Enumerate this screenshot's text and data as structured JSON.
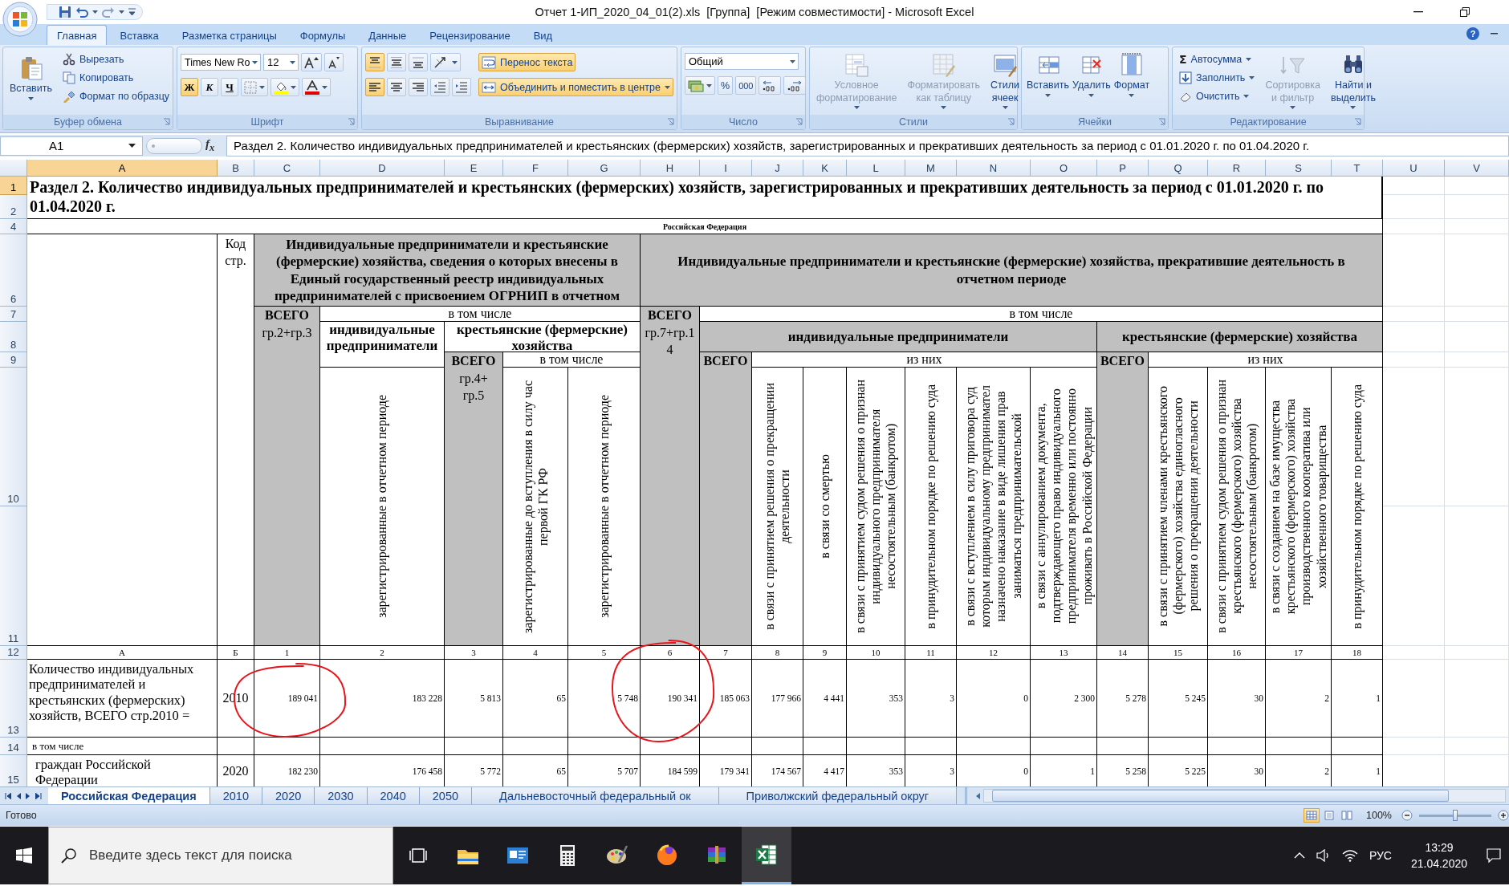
{
  "window": {
    "title": "Отчет 1-ИП_2020_04_01(2).xls  [Группа]  [Режим совместимости] - Microsoft Excel"
  },
  "ribbon": {
    "tabs": [
      {
        "label": "Главная",
        "selected": true
      },
      {
        "label": "Вставка",
        "selected": false
      },
      {
        "label": "Разметка страницы",
        "selected": false
      },
      {
        "label": "Формулы",
        "selected": false
      },
      {
        "label": "Данные",
        "selected": false
      },
      {
        "label": "Рецензирование",
        "selected": false
      },
      {
        "label": "Вид",
        "selected": false
      }
    ],
    "help": "?",
    "clipboard": {
      "label": "Буфер обмена",
      "paste": "Вставить",
      "actions": [
        "Вырезать",
        "Копировать",
        "Формат по образцу"
      ]
    },
    "font": {
      "label": "Шрифт",
      "font_name": "Times New Ro",
      "font_size": "12",
      "style_buttons": [
        {
          "label": "Ж",
          "pressed": true
        },
        {
          "label": "К",
          "pressed": false
        },
        {
          "label": "Ч",
          "pressed": false
        }
      ]
    },
    "alignment": {
      "label": "Выравнивание",
      "vertical_buttons": [
        {
          "pressed": true
        },
        {
          "pressed": false
        },
        {
          "pressed": false
        }
      ],
      "horizontal_buttons": [
        {
          "pressed": true
        },
        {
          "pressed": false
        },
        {
          "pressed": false
        }
      ],
      "wrap_text": {
        "label": "Перенос текста",
        "pressed": true
      },
      "merge": {
        "label": "Объединить и поместить в центре",
        "pressed": true
      }
    },
    "number": {
      "label": "Число",
      "format": "Общий",
      "percent": "%",
      "thousands": "000"
    },
    "styles": {
      "label": "Стили",
      "buttons": [
        {
          "label": "Условное\nформатирование",
          "disabled": true
        },
        {
          "label": "Форматировать\nкак таблицу",
          "disabled": true
        },
        {
          "label": "Стили\nячеек",
          "disabled": false
        }
      ]
    },
    "cells": {
      "label": "Ячейки",
      "buttons": [
        "Вставить",
        "Удалить",
        "Формат"
      ]
    },
    "editing": {
      "label": "Редактирование",
      "sigma": "Σ",
      "actions": [
        "Автосумма",
        "Заполнить",
        "Очистить"
      ],
      "buttons": [
        {
          "label": "Сортировка\nи фильтр",
          "disabled": true
        },
        {
          "label": "Найти и\nвыделить",
          "disabled": false
        }
      ]
    }
  },
  "formula_bar": {
    "name_box": "A1",
    "function_label": "f$_{x}$",
    "formula": "Раздел 2. Количество индивидуальных предпринимателей и крестьянских (фермерских) хозяйств, зарегистрированных и прекративших деятельность за период с 01.01.2020 г. по 01.04.2020 г."
  },
  "sheet": {
    "columns": [
      {
        "label": "A",
        "selected": true
      },
      {
        "label": "B",
        "selected": false
      },
      {
        "label": "C",
        "selected": false
      },
      {
        "label": "D",
        "selected": false
      },
      {
        "label": "E",
        "selected": false
      },
      {
        "label": "F",
        "selected": false
      },
      {
        "label": "G",
        "selected": false
      },
      {
        "label": "H",
        "selected": false
      },
      {
        "label": "I",
        "selected": false
      },
      {
        "label": "J",
        "selected": false
      },
      {
        "label": "K",
        "selected": false
      },
      {
        "label": "L",
        "selected": false
      },
      {
        "label": "M",
        "selected": false
      },
      {
        "label": "N",
        "selected": false
      },
      {
        "label": "O",
        "selected": false
      },
      {
        "label": "P",
        "selected": false
      },
      {
        "label": "Q",
        "selected": false
      },
      {
        "label": "R",
        "selected": false
      },
      {
        "label": "S",
        "selected": false
      },
      {
        "label": "T",
        "selected": false
      },
      {
        "label": "U",
        "selected": false
      },
      {
        "label": "V",
        "selected": false
      }
    ],
    "rows": [
      {
        "label": "1",
        "selected": true
      },
      {
        "label": "2",
        "selected": false
      },
      {
        "label": "4",
        "selected": false
      },
      {
        "label": "6",
        "selected": false
      },
      {
        "label": "7",
        "selected": false
      },
      {
        "label": "8",
        "selected": false
      },
      {
        "label": "9",
        "selected": false
      },
      {
        "label": "10",
        "selected": false
      },
      {
        "label": "11",
        "selected": false
      },
      {
        "label": "12",
        "selected": false
      },
      {
        "label": "13",
        "selected": false
      },
      {
        "label": "14",
        "selected": false
      },
      {
        "label": "15",
        "selected": false
      }
    ],
    "title": "Раздел 2. Количество индивидуальных предпринимателей и крестьянских (фермерских) хозяйств, зарегистрированных и прекративших деятельность за период с 01.01.2020 г. по\n01.04.2020 г.",
    "region": "Российская Федерация",
    "header_cells": [
      {
        "kind": "label",
        "text": "Код\nстр."
      },
      {
        "kind": "group",
        "text": "Индивидуальные предприниматели и крестьянские\n(фермерские) хозяйства, сведения о которых внесены в\nЕдиный государственный реестр индивидуальных\nпредпринимателей  с присвоением ОГРНИП в отчетном"
      },
      {
        "kind": "group",
        "text": "Индивидуальные предприниматели и крестьянские (фермерские) хозяйства, прекратившие деятельность в\nотчетном периоде"
      },
      {
        "kind": "total",
        "text": "**ВСЕГО**\nгр.2+гр.3"
      },
      {
        "kind": "caption",
        "text": "в том числе"
      },
      {
        "kind": "subgroup",
        "text": "индивидуальные\nпредприниматели"
      },
      {
        "kind": "subgroup",
        "text": "крестьянские (фермерские)\nхозяйства"
      },
      {
        "kind": "rotated",
        "text": "зарегистрированные в отчетном периоде"
      },
      {
        "kind": "total",
        "text": "**ВСЕГО**\nгр.4+\nгр.5"
      },
      {
        "kind": "caption",
        "text": "в том числе"
      },
      {
        "kind": "rotated",
        "text": "зарегистрированные до вступления в силу час\nпервой ГК РФ"
      },
      {
        "kind": "rotated",
        "text": "зарегистрированные в отчетном периоде"
      },
      {
        "kind": "total",
        "text": "**ВСЕГО**\nгр.7+гр.1\n4"
      },
      {
        "kind": "caption",
        "text": "в том числе"
      },
      {
        "kind": "group",
        "text": "индивидуальные предприниматели"
      },
      {
        "kind": "group",
        "text": "крестьянские (фермерские) хозяйства"
      },
      {
        "kind": "total",
        "text": "**ВСЕГО**"
      },
      {
        "kind": "caption",
        "text": "из них"
      },
      {
        "kind": "rotated",
        "text": "в связи с принятием решения о прекращении\nдеятельности"
      },
      {
        "kind": "rotated",
        "text": "в связи со смертью"
      },
      {
        "kind": "rotated",
        "text": "в связи с принятием судом решения о признан\nиндивидуального предпринимателя\nнесостоятельным (банкротом)"
      },
      {
        "kind": "rotated",
        "text": "в принудительном порядке по решению суда"
      },
      {
        "kind": "rotated",
        "text": "в связи с вступлением в силу приговора суд\nкоторым индивидуальному предпринимател\nназначено наказание в виде лишения прав\nзаниматься предпринимательской"
      },
      {
        "kind": "rotated",
        "text": "в связи с аннулированием документа,\nподтверждающего право индивидуального\nпредпринимателя временно или постоянно\nпроживать в Российской Федерации"
      },
      {
        "kind": "total",
        "text": "**ВСЕГО**"
      },
      {
        "kind": "caption",
        "text": "из них"
      },
      {
        "kind": "rotated",
        "text": "в связи с принятием членами крестьянского\n(фермерского) хозяйства единогласного\nрешения о прекращении деятельности"
      },
      {
        "kind": "rotated",
        "text": "в связи с принятием судом решения о признан\nкрестьянского (фермерского) хозяйства\nнесостоятельным (банкротом)"
      },
      {
        "kind": "rotated",
        "text": "в связи с созданием на базе имущества\nкрестьянского (фермерского) хозяйства\nпроизводственного кооператива или\nхозяйственного товарищества"
      },
      {
        "kind": "rotated",
        "text": "в принудительном порядке по решению суда"
      }
    ],
    "column_numbers": [
      "А",
      "Б",
      "1",
      "2",
      "3",
      "4",
      "5",
      "6",
      "7",
      "8",
      "9",
      "10",
      "11",
      "12",
      "13",
      "14",
      "15",
      "16",
      "17",
      "18"
    ],
    "data_rows": [
      {
        "kind": "total",
        "label": "Количество индивидуальных\nпредпринимателей и\nкрестьянских (фермерских)\nхозяйств, ВСЕГО стр.2010 =",
        "code": "2010",
        "values": [
          "189 041",
          "183 228",
          "5 813",
          "65",
          "5 748",
          "190 341",
          "185 063",
          "177 966",
          "4 441",
          "353",
          "3",
          "0",
          "2 300",
          "5 278",
          "5 245",
          "30",
          "2",
          "1"
        ]
      },
      {
        "kind": "caption",
        "label": "в том числе"
      },
      {
        "kind": "sub",
        "label": "граждан Российской\nФедерации",
        "code": "2020",
        "values": [
          "182 230",
          "176 458",
          "5 772",
          "65",
          "5 707",
          "184 599",
          "179 341",
          "174 567",
          "4 417",
          "353",
          "3",
          "0",
          "1",
          "5 258",
          "5 225",
          "30",
          "2",
          "1"
        ]
      }
    ]
  },
  "sheet_tabs": [
    {
      "label": "Российская Федерация",
      "selected": true
    },
    {
      "label": "2010",
      "selected": false
    },
    {
      "label": "2020",
      "selected": false
    },
    {
      "label": "2030",
      "selected": false
    },
    {
      "label": "2040",
      "selected": false
    },
    {
      "label": "2050",
      "selected": false
    },
    {
      "label": "Дальневосточный федеральный ок",
      "selected": false
    },
    {
      "label": "Приволжский федеральный округ",
      "selected": false
    }
  ],
  "status_bar": {
    "text": "Готово",
    "views": [
      {
        "selected": true
      },
      {
        "selected": false
      },
      {
        "selected": false
      }
    ],
    "zoom": "100%",
    "zoom_slider": {
      "level": 0.5
    }
  },
  "taskbar": {
    "search_placeholder": "Введите здесь текст для поиска",
    "apps": [
      {
        "selected": false
      },
      {
        "selected": false
      },
      {
        "selected": false
      },
      {
        "selected": false
      },
      {
        "selected": false
      },
      {
        "selected": false
      },
      {
        "selected": true
      }
    ],
    "language": "РУС",
    "time": "13:29",
    "date": "21.04.2020"
  }
}
